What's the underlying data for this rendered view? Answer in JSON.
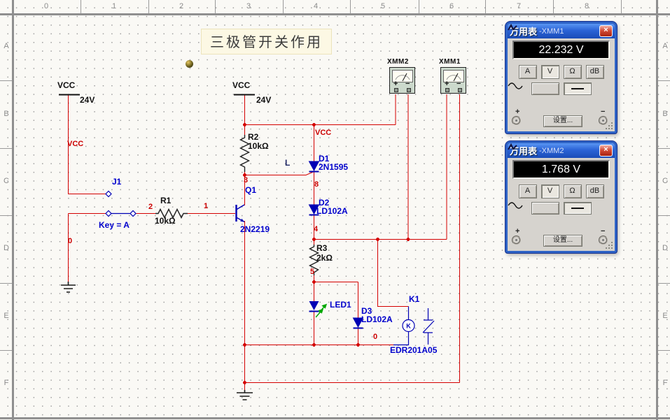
{
  "sheet": {
    "columns": [
      "0",
      "1",
      "2",
      "3",
      "4",
      "5",
      "6",
      "7",
      "8"
    ],
    "rows": [
      "A",
      "B",
      "C",
      "D",
      "E",
      "F"
    ]
  },
  "note": {
    "text": "三极管开关作用"
  },
  "schematic": {
    "supplies": {
      "left": {
        "name": "VCC",
        "value": "24V"
      },
      "mid": {
        "name": "VCC",
        "value": "24V"
      }
    },
    "nets": {
      "vcc_left": "VCC",
      "vcc_mid": "VCC",
      "n0_left": "0",
      "n0_right": "0",
      "n1": "1",
      "n2": "2",
      "n3": "3",
      "n4": "4",
      "n5": "5",
      "n8": "8",
      "l": "L"
    },
    "components": {
      "j1": {
        "ref": "J1",
        "key": "Key = A"
      },
      "r1": {
        "ref": "R1",
        "value": "10kΩ"
      },
      "r2": {
        "ref": "R2",
        "value": "10kΩ"
      },
      "r3": {
        "ref": "R3",
        "value": "2kΩ"
      },
      "q1": {
        "ref": "Q1",
        "value": "2N2219"
      },
      "d1": {
        "ref": "D1",
        "value": "2N1595"
      },
      "d2": {
        "ref": "D2",
        "value": "LD102A"
      },
      "d3": {
        "ref": "D3",
        "value": "LD102A"
      },
      "led1": {
        "ref": "LED1"
      },
      "k1": {
        "ref": "K1",
        "value": "EDR201A05",
        "coil_letter": "K"
      }
    },
    "instruments": [
      {
        "label": "XMM2",
        "plus": "+",
        "minus": "−"
      },
      {
        "label": "XMM1",
        "plus": "+",
        "minus": "−"
      }
    ]
  },
  "panels": [
    {
      "title": "万用表",
      "suffix": "-XMM1",
      "close": "×",
      "reading": "22.232 V",
      "buttons": [
        "A",
        "V",
        "Ω",
        "dB"
      ],
      "settings": "设置...",
      "plus": "+",
      "minus": "−"
    },
    {
      "title": "万用表",
      "suffix": "-XMM2",
      "close": "×",
      "reading": "1.768 V",
      "buttons": [
        "A",
        "V",
        "Ω",
        "dB"
      ],
      "settings": "设置...",
      "plus": "+",
      "minus": "−"
    }
  ]
}
